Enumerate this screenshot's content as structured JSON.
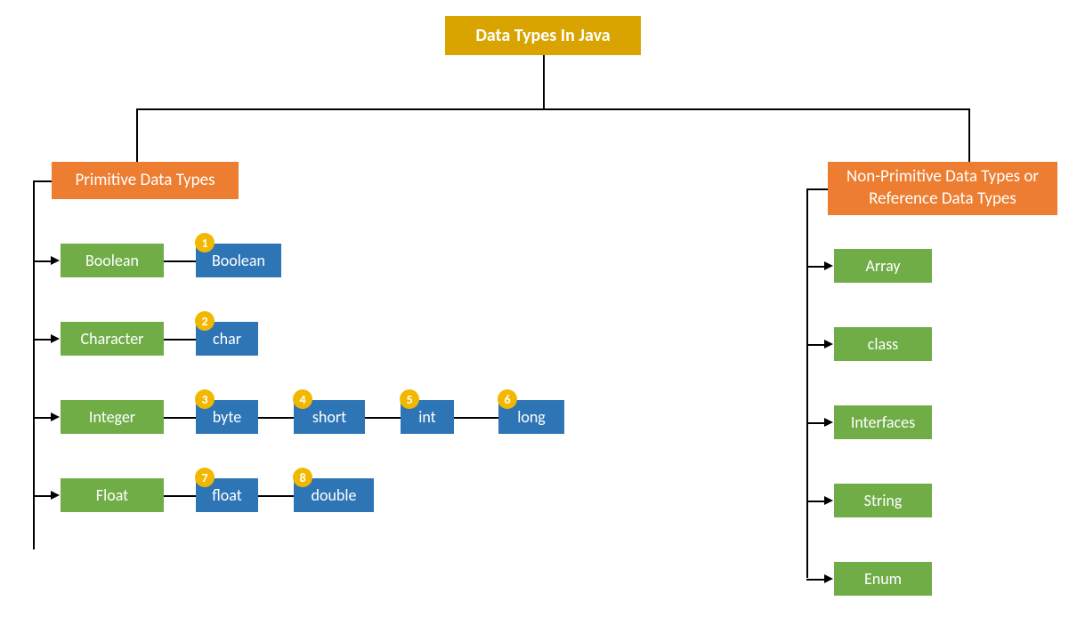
{
  "title": "Data Types In Java",
  "primitive": {
    "header": "Primitive Data Types",
    "categories": [
      {
        "label": "Boolean",
        "types": [
          {
            "num": "1",
            "label": "Boolean"
          }
        ]
      },
      {
        "label": "Character",
        "types": [
          {
            "num": "2",
            "label": "char"
          }
        ]
      },
      {
        "label": "Integer",
        "types": [
          {
            "num": "3",
            "label": "byte"
          },
          {
            "num": "4",
            "label": "short"
          },
          {
            "num": "5",
            "label": "int"
          },
          {
            "num": "6",
            "label": "long"
          }
        ]
      },
      {
        "label": "Float",
        "types": [
          {
            "num": "7",
            "label": "float"
          },
          {
            "num": "8",
            "label": "double"
          }
        ]
      }
    ]
  },
  "nonprimitive": {
    "header": "Non-Primitive Data Types or Reference Data Types",
    "items": [
      "Array",
      "class",
      "Interfaces",
      "String",
      "Enum"
    ]
  }
}
